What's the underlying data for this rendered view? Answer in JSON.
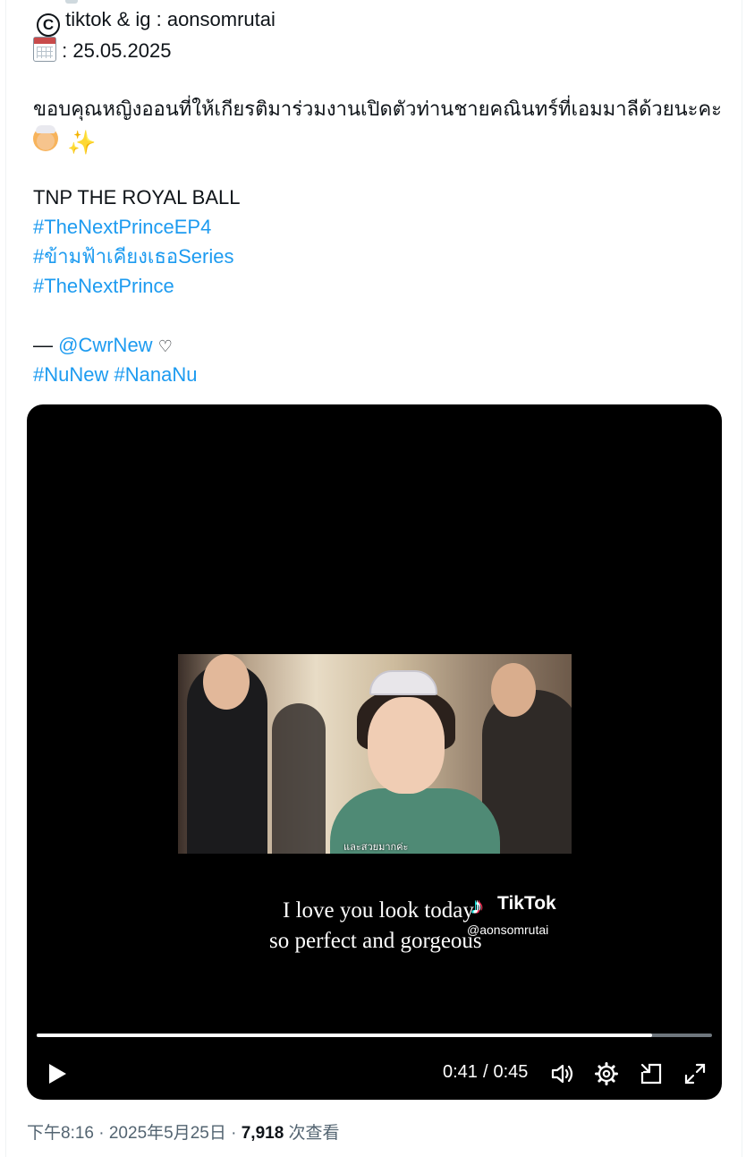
{
  "tweet": {
    "line_source": "tiktok & ig : aonsomrutai",
    "line_date": ": 25.05.2025",
    "line_thanks": "ขอบคุณหญิงออนที่ให้เกียรติมาร่วมงานเปิดตัวท่านชายคณินทร์ที่เอมมาลีด้วยนะคะ",
    "line_event": "TNP THE ROYAL BALL",
    "hashtags": [
      "#TheNextPrinceEP4",
      "#ข้ามฟ้าเคียงเธอSeries",
      "#TheNextPrince"
    ],
    "credit_prefix": "—",
    "credit_mention": "@CwrNew",
    "credit_heart": "♡",
    "hashtags_2": [
      "#NuNew",
      "#NanaNu"
    ],
    "icons": [
      "copyright-icon",
      "calendar-icon",
      "bride-icon",
      "sparkles-icon"
    ]
  },
  "video": {
    "subtitle_thai": "และสวยมากค่ะ",
    "caption_line1": "I love you look today",
    "caption_line2": "so perfect and gorgeous",
    "watermark_brand": "TikTok",
    "watermark_handle": "@aonsomrutai",
    "current_time": "0:41",
    "duration": "0:45",
    "time_separator": "/",
    "progress": 0.911
  },
  "meta": {
    "timestamp": "下午8:16 · 2025年5月25日 · ",
    "views_count": "7,918",
    "views_label": " 次查看"
  },
  "colors": {
    "link": "#1d9bf0",
    "text": "#0f1419",
    "muted": "#536471",
    "video_bg": "#000000"
  }
}
